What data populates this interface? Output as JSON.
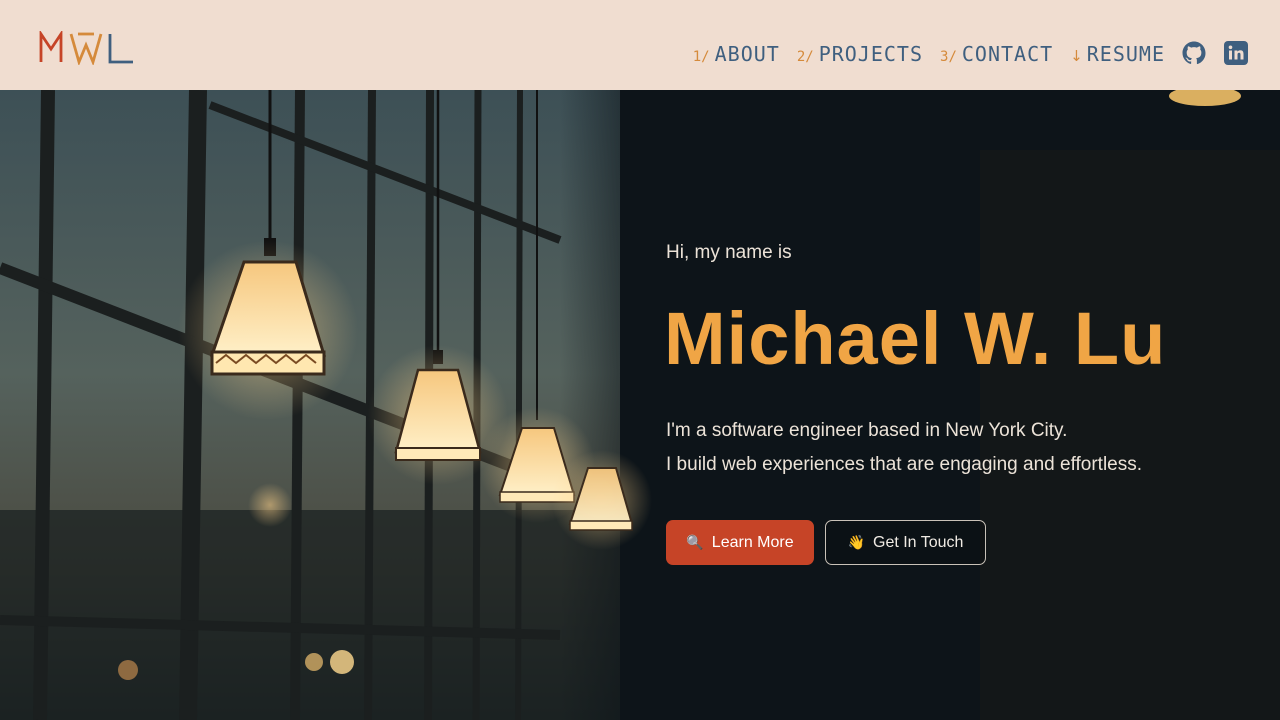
{
  "brand": {
    "logo_text": "MWL"
  },
  "nav": {
    "items": [
      {
        "num": "1/",
        "label": "ABOUT"
      },
      {
        "num": "2/",
        "label": "PROJECTS"
      },
      {
        "num": "3/",
        "label": "CONTACT"
      }
    ],
    "resume": {
      "arrow": "↓",
      "label": "RESUME"
    },
    "social": {
      "github_icon": "github-icon",
      "linkedin_icon": "linkedin-icon"
    }
  },
  "hero": {
    "intro": "Hi, my name is",
    "name": "Michael W. Lu",
    "bio_line1": "I'm a software engineer based in New York City.",
    "bio_line2": "I build web experiences that are engaging and effortless.",
    "primary_button": {
      "icon": "🔍",
      "label": "Learn More"
    },
    "secondary_button": {
      "icon": "👋",
      "label": "Get In Touch"
    }
  },
  "colors": {
    "header_bg": "#f0ddd0",
    "nav_text": "#3f5f7f",
    "accent_orange": "#d58a3b",
    "name_color": "#f0a545",
    "primary_button": "#c64427"
  }
}
